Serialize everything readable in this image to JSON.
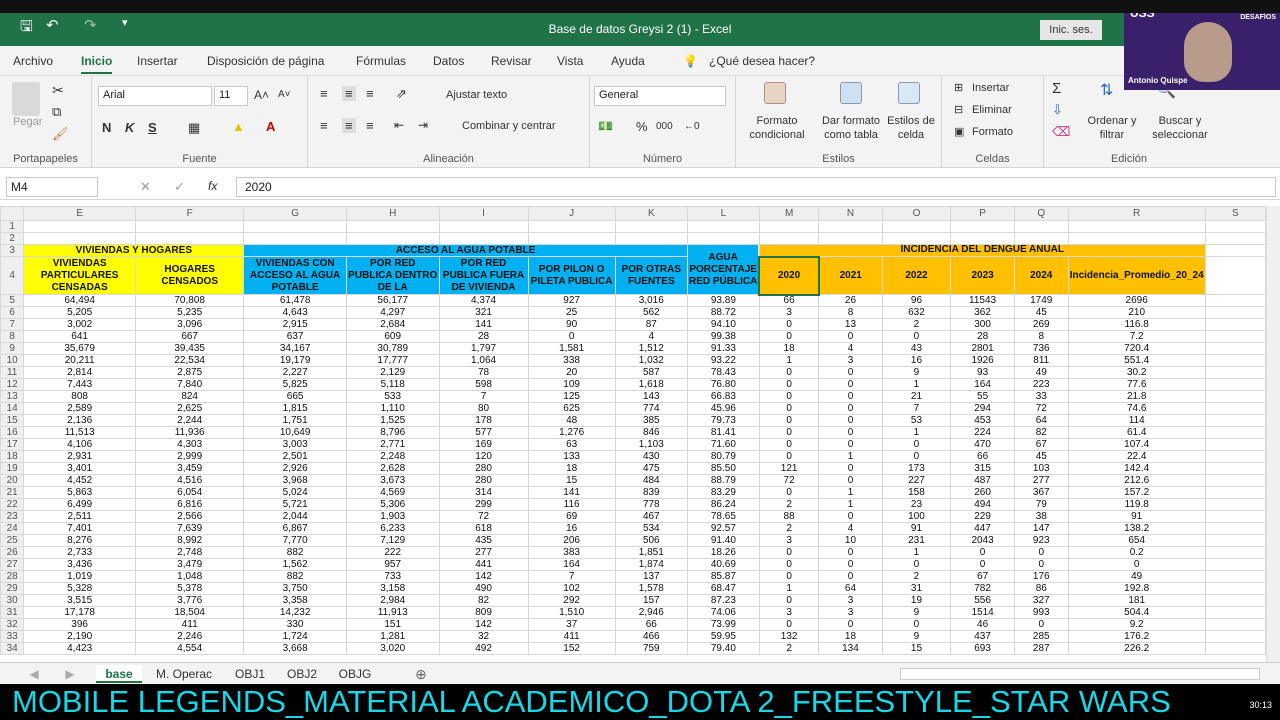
{
  "window": {
    "title": "Base de datos Greysi 2 (1)  -  Excel",
    "signin": "Inic. ses."
  },
  "menu": [
    "Archivo",
    "Inicio",
    "Insertar",
    "Disposición de página",
    "Fórmulas",
    "Datos",
    "Revisar",
    "Vista",
    "Ayuda"
  ],
  "tellme": "¿Qué desea hacer?",
  "ribbon": {
    "paste": "Pegar",
    "clipboard": "Portapapeles",
    "font_name": "Arial",
    "font_size": "11",
    "bold": "N",
    "italic": "K",
    "underline": "S",
    "font_group": "Fuente",
    "wrap": "Ajustar texto",
    "merge": "Combinar y centrar",
    "align_group": "Alineación",
    "number_format": "General",
    "percent": "%",
    "thousands": "000",
    "number_group": "Número",
    "cond_format": "Formato condicional",
    "table_format": "Dar formato como tabla",
    "cell_styles": "Estilos de celda",
    "styles_group": "Estilos",
    "insert": "Insertar",
    "delete": "Eliminar",
    "format": "Formato",
    "cells_group": "Celdas",
    "sort": "Ordenar y filtrar",
    "find": "Buscar y seleccionar",
    "edit_group": "Edición"
  },
  "formula_bar": {
    "cell": "M4",
    "value": "2020",
    "fx": "fx"
  },
  "columns": [
    "E",
    "F",
    "G",
    "H",
    "I",
    "J",
    "K",
    "L",
    "M",
    "N",
    "O",
    "P",
    "Q",
    "R",
    "S"
  ],
  "headers": {
    "group_viviendas": "VIVIENDAS Y HOGARES",
    "group_agua": "ACCESO AL AGUA POTABLE",
    "group_dengue": "INCIDENCIA DEL DENGUE ANUAL",
    "E": "VIVIENDAS PARTICULARES CENSADAS",
    "F": "HOGARES CENSADOS",
    "G": "VIVIENDAS CON ACCESO AL AGUA POTABLE",
    "H": "POR RED PUBLICA DENTRO DE LA",
    "I": "POR RED PUBLICA FUERA DE VIVIENDA",
    "J": "POR PILON O PILETA PUBLICA",
    "K": "POR OTRAS FUENTES",
    "L": "AGUA PORCENTAJE RED PÚBLICA",
    "M": "2020",
    "N": "2021",
    "O": "2022",
    "P": "2023",
    "Q": "2024",
    "R": "Incidencia_Promedio_20_24"
  },
  "rows": [
    [
      "5",
      "64,494",
      "70,808",
      "61,478",
      "56,177",
      "4,374",
      "927",
      "3,016",
      "93.89",
      "66",
      "26",
      "96",
      "11543",
      "1749",
      "2696"
    ],
    [
      "6",
      "5,205",
      "5,235",
      "4,643",
      "4,297",
      "321",
      "25",
      "562",
      "88.72",
      "3",
      "8",
      "632",
      "362",
      "45",
      "210"
    ],
    [
      "7",
      "3,002",
      "3,096",
      "2,915",
      "2,684",
      "141",
      "90",
      "87",
      "94.10",
      "0",
      "13",
      "2",
      "300",
      "269",
      "116.8"
    ],
    [
      "8",
      "641",
      "667",
      "637",
      "609",
      "28",
      "0",
      "4",
      "99.38",
      "0",
      "0",
      "0",
      "28",
      "8",
      "7.2"
    ],
    [
      "9",
      "35,679",
      "39,435",
      "34,167",
      "30,789",
      "1,797",
      "1,581",
      "1,512",
      "91.33",
      "18",
      "4",
      "43",
      "2801",
      "736",
      "720.4"
    ],
    [
      "10",
      "20,211",
      "22,534",
      "19,179",
      "17,777",
      "1,064",
      "338",
      "1,032",
      "93.22",
      "1",
      "3",
      "16",
      "1926",
      "811",
      "551.4"
    ],
    [
      "11",
      "2,814",
      "2,875",
      "2,227",
      "2,129",
      "78",
      "20",
      "587",
      "78.43",
      "0",
      "0",
      "9",
      "93",
      "49",
      "30.2"
    ],
    [
      "12",
      "7,443",
      "7,840",
      "5,825",
      "5,118",
      "598",
      "109",
      "1,618",
      "76.80",
      "0",
      "0",
      "1",
      "164",
      "223",
      "77.6"
    ],
    [
      "13",
      "808",
      "824",
      "665",
      "533",
      "7",
      "125",
      "143",
      "66.83",
      "0",
      "0",
      "21",
      "55",
      "33",
      "21.8"
    ],
    [
      "14",
      "2,589",
      "2,625",
      "1,815",
      "1,110",
      "80",
      "625",
      "774",
      "45.96",
      "0",
      "0",
      "7",
      "294",
      "72",
      "74.6"
    ],
    [
      "15",
      "2,136",
      "2,244",
      "1,751",
      "1,525",
      "178",
      "48",
      "385",
      "79.73",
      "0",
      "0",
      "53",
      "453",
      "64",
      "114"
    ],
    [
      "16",
      "11,513",
      "11,936",
      "10,649",
      "8,796",
      "577",
      "1,276",
      "846",
      "81.41",
      "0",
      "0",
      "1",
      "224",
      "82",
      "61.4"
    ],
    [
      "17",
      "4,106",
      "4,303",
      "3,003",
      "2,771",
      "169",
      "63",
      "1,103",
      "71.60",
      "0",
      "0",
      "0",
      "470",
      "67",
      "107.4"
    ],
    [
      "18",
      "2,931",
      "2,999",
      "2,501",
      "2,248",
      "120",
      "133",
      "430",
      "80.79",
      "0",
      "1",
      "0",
      "66",
      "45",
      "22.4"
    ],
    [
      "19",
      "3,401",
      "3,459",
      "2,926",
      "2,628",
      "280",
      "18",
      "475",
      "85.50",
      "121",
      "0",
      "173",
      "315",
      "103",
      "142.4"
    ],
    [
      "20",
      "4,452",
      "4,516",
      "3,968",
      "3,673",
      "280",
      "15",
      "484",
      "88.79",
      "72",
      "0",
      "227",
      "487",
      "277",
      "212.6"
    ],
    [
      "21",
      "5,863",
      "6,054",
      "5,024",
      "4,569",
      "314",
      "141",
      "839",
      "83.29",
      "0",
      "1",
      "158",
      "260",
      "367",
      "157.2"
    ],
    [
      "22",
      "6,499",
      "6,816",
      "5,721",
      "5,306",
      "299",
      "116",
      "778",
      "86.24",
      "2",
      "1",
      "23",
      "494",
      "79",
      "119.8"
    ],
    [
      "23",
      "2,511",
      "2,566",
      "2,044",
      "1,903",
      "72",
      "69",
      "467",
      "78.65",
      "88",
      "0",
      "100",
      "229",
      "38",
      "91"
    ],
    [
      "24",
      "7,401",
      "7,639",
      "6,867",
      "6,233",
      "618",
      "16",
      "534",
      "92.57",
      "2",
      "4",
      "91",
      "447",
      "147",
      "138.2"
    ],
    [
      "25",
      "8,276",
      "8,992",
      "7,770",
      "7,129",
      "435",
      "206",
      "506",
      "91.40",
      "3",
      "10",
      "231",
      "2043",
      "923",
      "654"
    ],
    [
      "26",
      "2,733",
      "2,748",
      "882",
      "222",
      "277",
      "383",
      "1,851",
      "18.26",
      "0",
      "0",
      "1",
      "0",
      "0",
      "0.2"
    ],
    [
      "27",
      "3,436",
      "3,479",
      "1,562",
      "957",
      "441",
      "164",
      "1,874",
      "40.69",
      "0",
      "0",
      "0",
      "0",
      "0",
      "0"
    ],
    [
      "28",
      "1,019",
      "1,048",
      "882",
      "733",
      "142",
      "7",
      "137",
      "85.87",
      "0",
      "0",
      "2",
      "67",
      "176",
      "49"
    ],
    [
      "29",
      "5,328",
      "5,378",
      "3,750",
      "3,158",
      "490",
      "102",
      "1,578",
      "68.47",
      "1",
      "64",
      "31",
      "782",
      "86",
      "192.8"
    ],
    [
      "30",
      "3,515",
      "3,776",
      "3,358",
      "2,984",
      "82",
      "292",
      "157",
      "87.23",
      "0",
      "3",
      "19",
      "556",
      "327",
      "181"
    ],
    [
      "31",
      "17,178",
      "18,504",
      "14,232",
      "11,913",
      "809",
      "1,510",
      "2,946",
      "74.06",
      "3",
      "3",
      "9",
      "1514",
      "993",
      "504.4"
    ],
    [
      "32",
      "396",
      "411",
      "330",
      "151",
      "142",
      "37",
      "66",
      "73.99",
      "0",
      "0",
      "0",
      "46",
      "0",
      "9.2"
    ],
    [
      "33",
      "2,190",
      "2,246",
      "1,724",
      "1,281",
      "32",
      "411",
      "466",
      "59.95",
      "132",
      "18",
      "9",
      "437",
      "285",
      "176.2"
    ],
    [
      "34",
      "4,423",
      "4,554",
      "3,668",
      "3,020",
      "492",
      "152",
      "759",
      "79.40",
      "2",
      "134",
      "15",
      "693",
      "287",
      "226.2"
    ]
  ],
  "sheet_tabs": [
    "base",
    "M. Operac",
    "OBJ1",
    "OBJ2",
    "OBJG"
  ],
  "banner": "MOBILE LEGENDS_MATERIAL ACADEMICO_DOTA 2_FREESTYLE_STAR WARS",
  "time": "30:13",
  "webcam": {
    "logo": "USS",
    "slogan": "YO ENFRENTO DESAFÍOS",
    "name": "Antonio Quispe"
  }
}
